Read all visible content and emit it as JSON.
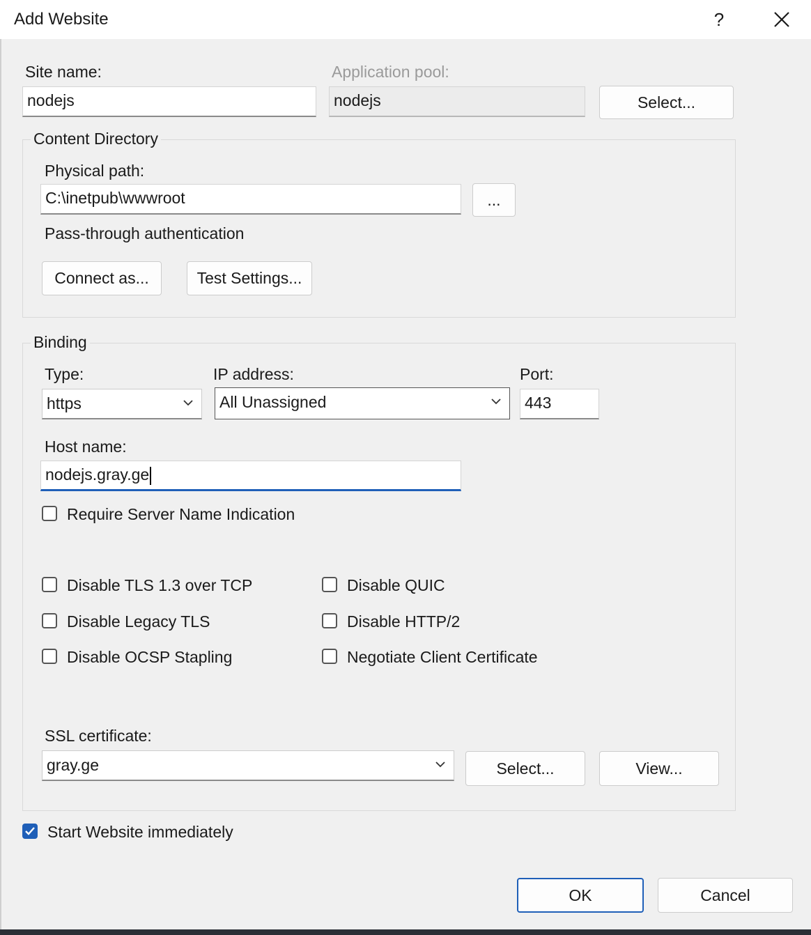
{
  "window": {
    "title": "Add Website",
    "help_label": "?",
    "close_icon": "close-icon"
  },
  "site": {
    "site_name_label": "Site name:",
    "site_name_value": "nodejs",
    "app_pool_label": "Application pool:",
    "app_pool_value": "nodejs",
    "select_label": "Select..."
  },
  "content": {
    "group_title": "Content Directory",
    "physical_path_label": "Physical path:",
    "physical_path_value": "C:\\inetpub\\wwwroot",
    "browse_label": "...",
    "passthrough_label": "Pass-through authentication",
    "connect_as_label": "Connect as...",
    "test_settings_label": "Test Settings..."
  },
  "binding": {
    "group_title": "Binding",
    "type_label": "Type:",
    "type_value": "https",
    "ip_label": "IP address:",
    "ip_value": "All Unassigned",
    "port_label": "Port:",
    "port_value": "443",
    "host_label": "Host name:",
    "host_value": "nodejs.gray.ge",
    "sni_label": "Require Server Name Indication",
    "sni_checked": false,
    "options": [
      {
        "label": "Disable TLS 1.3 over TCP",
        "checked": false
      },
      {
        "label": "Disable QUIC",
        "checked": false
      },
      {
        "label": "Disable Legacy TLS",
        "checked": false
      },
      {
        "label": "Disable HTTP/2",
        "checked": false
      },
      {
        "label": "Disable OCSP Stapling",
        "checked": false
      },
      {
        "label": "Negotiate Client Certificate",
        "checked": false
      }
    ],
    "ssl_label": "SSL certificate:",
    "ssl_value": "gray.ge",
    "ssl_select_label": "Select...",
    "ssl_view_label": "View..."
  },
  "start": {
    "label": "Start Website immediately",
    "checked": true
  },
  "footer": {
    "ok_label": "OK",
    "cancel_label": "Cancel"
  },
  "colors": {
    "accent": "#1f5fb8",
    "background": "#f0f0f0"
  }
}
